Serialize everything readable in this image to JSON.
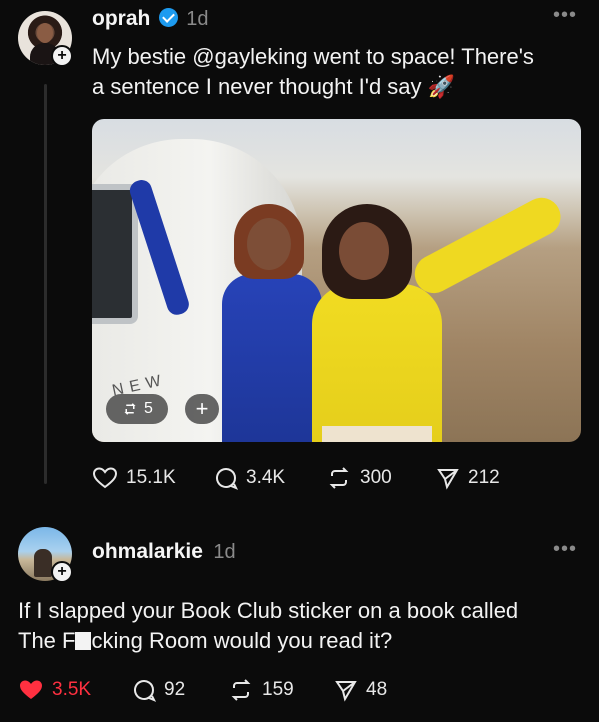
{
  "post": {
    "username": "oprah",
    "time": "1d",
    "text_line1_pre": "My bestie ",
    "mention": "@gayleking",
    "text_line1_post": " went to space! There's",
    "text_line2": "a sentence I never thought I'd say",
    "emoji": "🚀",
    "photo_caption": "NEW",
    "repost_chip_count": "5",
    "add_chip_label": "+",
    "stats": {
      "likes": "15.1K",
      "replies": "3.4K",
      "reposts": "300",
      "shares": "212"
    }
  },
  "reply": {
    "username": "ohmalarkie",
    "time": "1d",
    "text_line1": "If I slapped your Book Club sticker on a book called",
    "text_line2_pre": "The F",
    "text_line2_post": "cking Room would you read it?",
    "stats": {
      "likes": "3.5K",
      "replies": "92",
      "reposts": "159",
      "shares": "48"
    }
  },
  "colors": {
    "background": "#0b0b0b",
    "verified": "#1d9bf0",
    "liked": "#ff3040",
    "muted": "#8a8a8a"
  },
  "icons": [
    "heart-icon",
    "comment-icon",
    "repost-icon",
    "share-icon",
    "more-icon",
    "verified-icon",
    "plus-icon"
  ]
}
